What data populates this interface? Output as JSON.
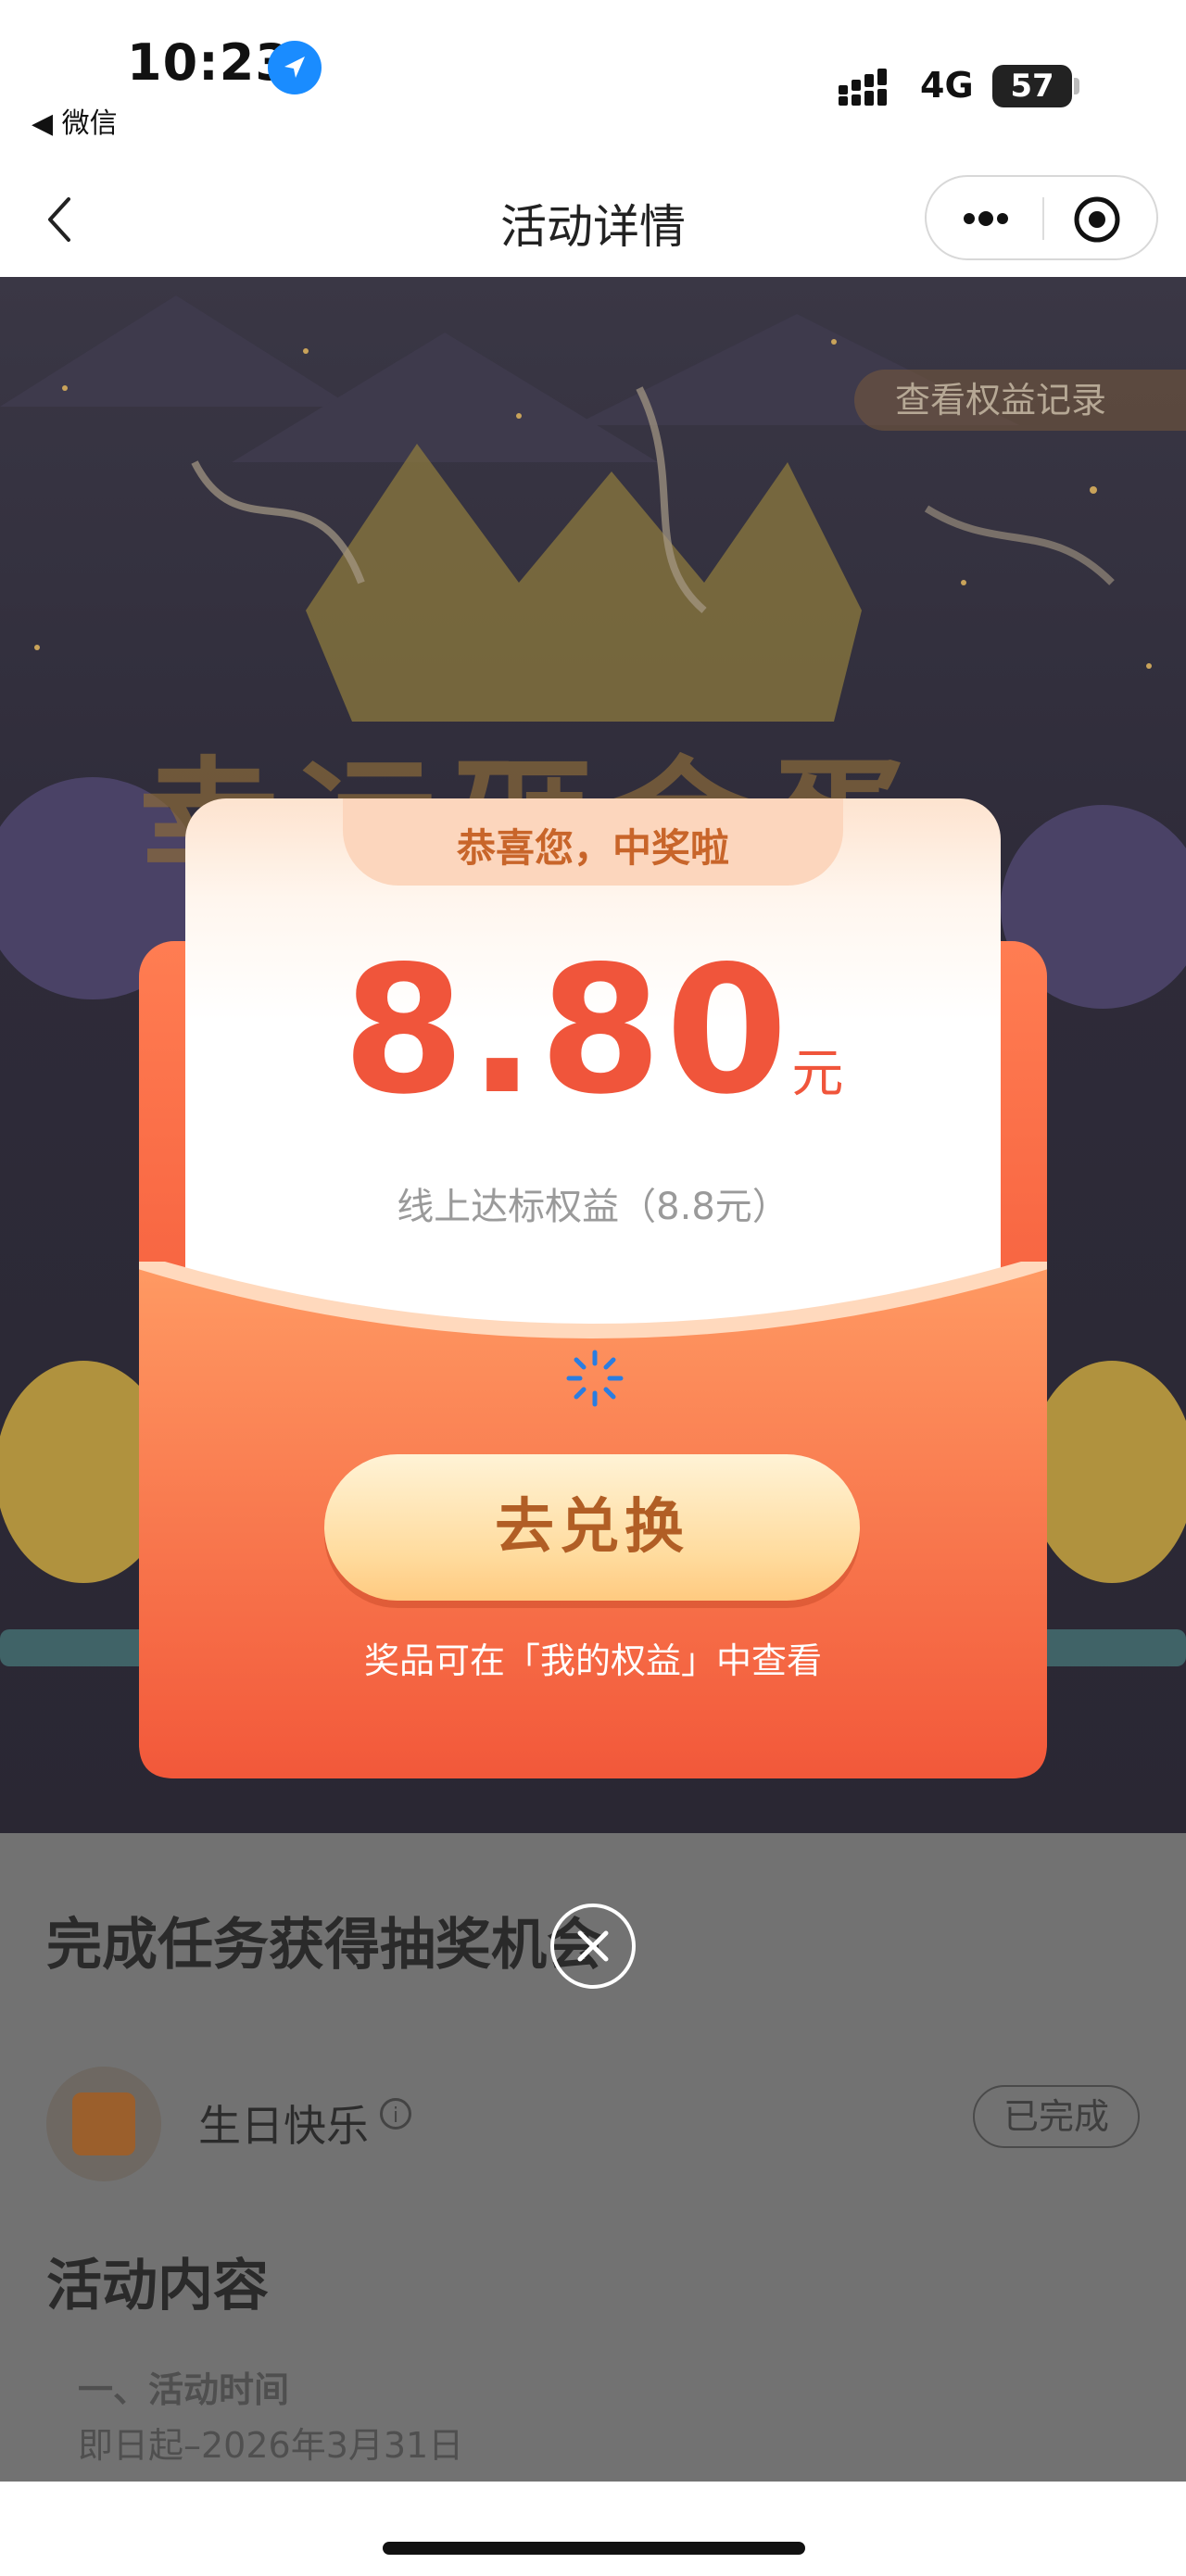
{
  "status_bar": {
    "time": "10:23",
    "back_app": "◀ 微信",
    "network": "4G",
    "battery": "57"
  },
  "nav": {
    "title": "活动详情",
    "more_icon": "more-dots-icon",
    "close_icon": "target-circle-icon"
  },
  "hero": {
    "record_button": "查看权益记录",
    "banner_title": "幸运砸金蛋"
  },
  "popup": {
    "congrats": "恭喜您，中奖啦",
    "amount": "8.80",
    "unit": "元",
    "desc": "线上达标权益（8.8元）",
    "redeem_button": "去兑换",
    "hint": "奖品可在「我的权益」中查看"
  },
  "content": {
    "task_section_title": "完成任务获得抽奖机会",
    "task": {
      "name": "生日快乐",
      "status": "已完成"
    },
    "activity_section_title": "活动内容",
    "activity_time_heading": "一、活动时间",
    "activity_time": "即日起–2026年3月31日"
  },
  "colors": {
    "accent_red": "#f0553b",
    "button_gold": "#ffdb9d",
    "link_blue": "#1a8cff"
  }
}
